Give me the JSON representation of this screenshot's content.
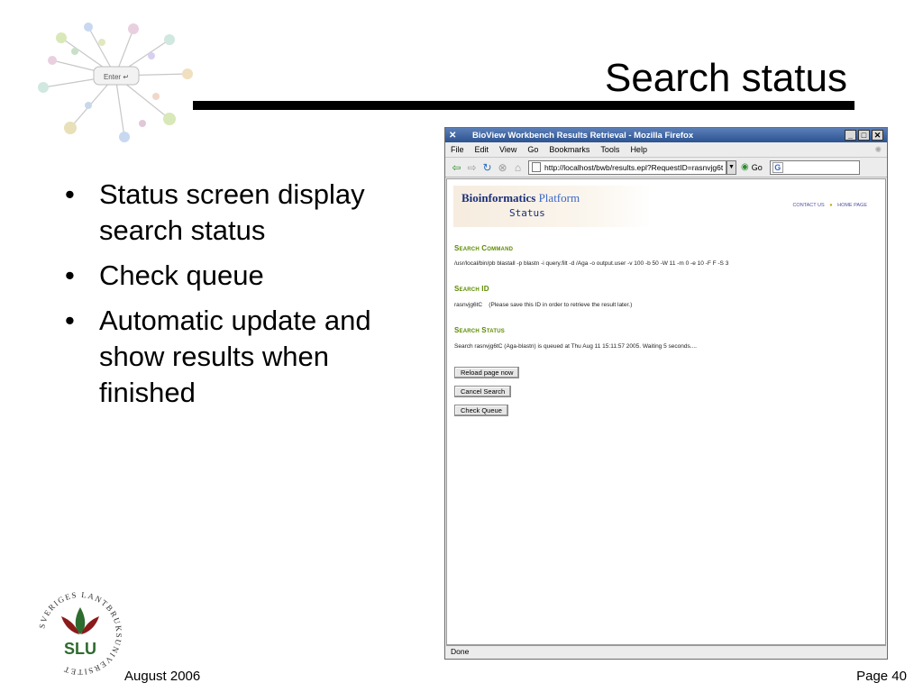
{
  "slide": {
    "title": "Search status",
    "bullets": [
      "Status screen display search status",
      "Check queue",
      "Automatic update and show results when finished"
    ],
    "footer_date": "August 2006",
    "footer_page": "Page 40",
    "enter_key_text": "Enter ↵",
    "slu_ring_text": "SVERIGES LANTBRUKSUNIVERSITET",
    "slu_letters": "SLU"
  },
  "browser": {
    "window_title": "BioView Workbench Results Retrieval - Mozilla Firefox",
    "menu": [
      "File",
      "Edit",
      "View",
      "Go",
      "Bookmarks",
      "Tools",
      "Help"
    ],
    "url": "http://localhost/bwb/results.epl?RequestID=rasnvjg6t",
    "go_label": "Go",
    "search_placeholder": "",
    "status_text": "Done",
    "icons": {
      "back": "back-arrow-icon",
      "forward": "forward-arrow-icon",
      "reload": "reload-icon",
      "stop": "stop-icon",
      "home": "home-icon"
    }
  },
  "page": {
    "banner_title_a": "Bioinformatics",
    "banner_title_b": "Platform",
    "banner_sub": "Status",
    "link_contact": "CONTACT US",
    "link_home": "HOME PAGE",
    "command_head": "Search Command",
    "command_text": "/usr/local/bin/pb blastall -p blastn -i query.filt -d /Aga -o output.user -v 100 -b 50 -W 11 -m 0 -e 10 -F F -S 3",
    "id_head": "Search ID",
    "id_text": "rasnvjg6tC    (Please save this ID in order to retrieve the result later.)",
    "status_head": "Search Status",
    "status_text": "Search rasnvjg6tC (Aga-blastn) is queued at Thu Aug 11 15:11:57 2005. Waiting 5 seconds....",
    "btn_reload": "Reload page now",
    "btn_cancel": "Cancel Search",
    "btn_queue": "Check Queue"
  },
  "colors": {
    "titlebar": "#2c5391",
    "section_head": "#5c8a00",
    "banner_text": "#1a2f7a",
    "slu_green": "#2e6b2e",
    "slu_red": "#8b1a1a"
  }
}
